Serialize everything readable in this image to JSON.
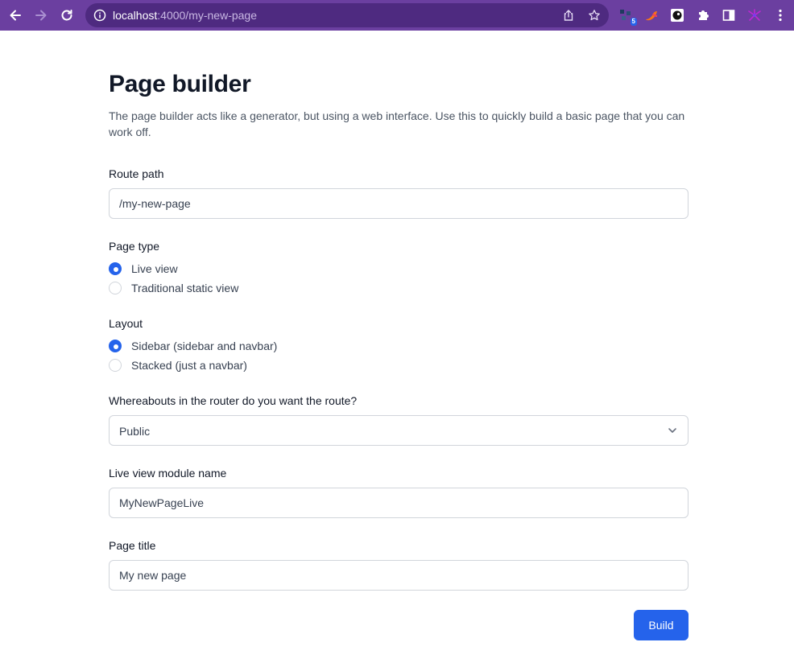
{
  "browser": {
    "url_host": "localhost",
    "url_path": ":4000/my-new-page",
    "extensions": [
      {
        "name": "extension-icon-1",
        "badge": "5"
      },
      {
        "name": "extension-icon-2"
      },
      {
        "name": "extension-icon-3"
      },
      {
        "name": "puzzle-icon"
      },
      {
        "name": "sidebar-icon"
      },
      {
        "name": "extension-icon-6"
      }
    ],
    "colors": {
      "frame": "#6b3fa0",
      "omnibox": "#4e2a80"
    }
  },
  "page": {
    "title": "Page builder",
    "description": "The page builder acts like a generator, but using a web interface. Use this to quickly build a basic page that you can work off."
  },
  "form": {
    "route_path": {
      "label": "Route path",
      "value": "/my-new-page"
    },
    "page_type": {
      "label": "Page type",
      "options": [
        {
          "label": "Live view",
          "checked": true
        },
        {
          "label": "Traditional static view",
          "checked": false
        }
      ]
    },
    "layout": {
      "label": "Layout",
      "options": [
        {
          "label": "Sidebar (sidebar and navbar)",
          "checked": true
        },
        {
          "label": "Stacked (just a navbar)",
          "checked": false
        }
      ]
    },
    "router_scope": {
      "label": "Whereabouts in the router do you want the route?",
      "value": "Public"
    },
    "module_name": {
      "label": "Live view module name",
      "value": "MyNewPageLive"
    },
    "page_title": {
      "label": "Page title",
      "value": "My new page"
    },
    "build_label": "Build"
  },
  "colors": {
    "accent": "#2563eb",
    "border": "#d1d5db"
  }
}
